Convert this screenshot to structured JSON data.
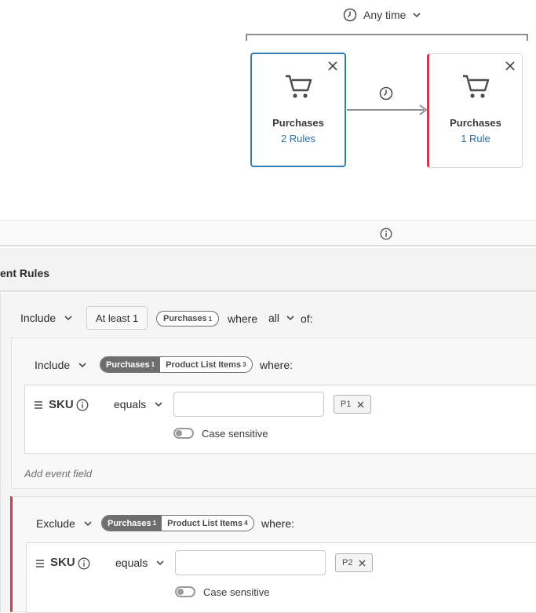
{
  "timeline": {
    "time_label": "Any time",
    "cards": [
      {
        "title": "Purchases",
        "rules": "2 Rules"
      },
      {
        "title": "Purchases",
        "rules": "1 Rule"
      }
    ]
  },
  "rules_header": {
    "title": "ent Rules"
  },
  "top_rule": {
    "mode": "Include",
    "count_button": "At least 1",
    "tag": "Purchases",
    "tag_sup": "1",
    "where": "where",
    "quantifier": "all",
    "of": "of:"
  },
  "blocks": [
    {
      "mode": "Include",
      "seg_a": "Purchases",
      "seg_a_sup": "1",
      "seg_b": "Product List Items",
      "seg_b_sup": "3",
      "where": "where:",
      "field": "SKU",
      "operator": "equals",
      "input_value": "",
      "chip": "P1",
      "toggle_label": "Case sensitive",
      "add_field": "Add event field"
    },
    {
      "mode": "Exclude",
      "seg_a": "Purchases",
      "seg_a_sup": "1",
      "seg_b": "Product List Items",
      "seg_b_sup": "4",
      "where": "where:",
      "field": "SKU",
      "operator": "equals",
      "input_value": "",
      "chip": "P2",
      "toggle_label": "Case sensitive"
    }
  ],
  "colors": {
    "accent_blue": "#2f7fbf",
    "link_blue": "#2b6ca8",
    "exclude_red": "#d3394b"
  }
}
